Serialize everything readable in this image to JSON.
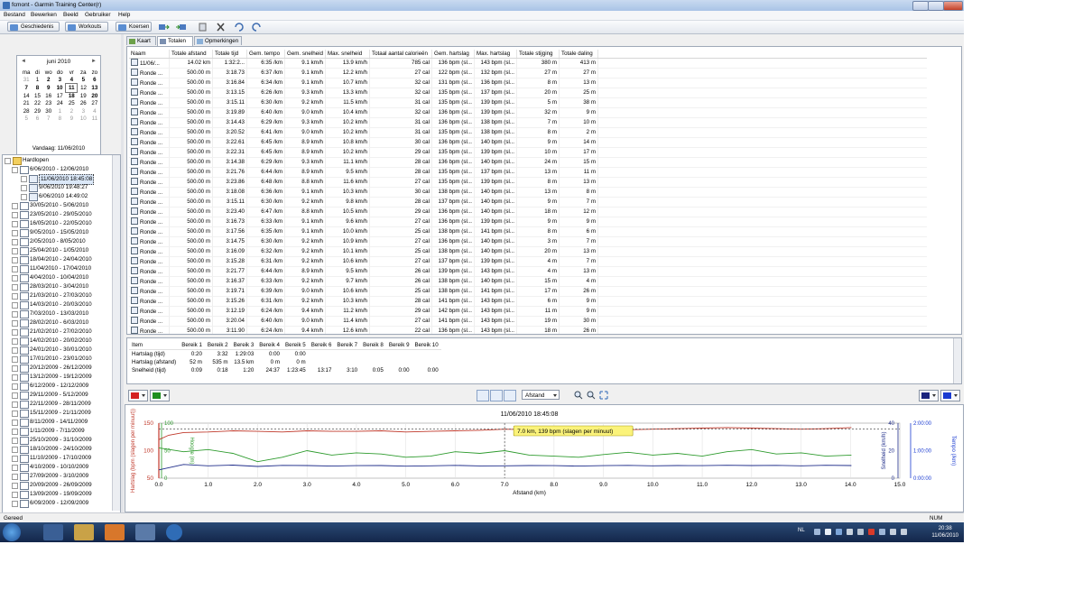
{
  "window": {
    "title": "fcmont - Garmin Training Center(r)"
  },
  "menu": [
    "Bestand",
    "Bewerken",
    "Beeld",
    "Gebruiker",
    "Help"
  ],
  "toolbar": {
    "history": "Geschiedenis",
    "workouts": "Workouts",
    "courses": "Koersen"
  },
  "calendar": {
    "caption": "juni 2010",
    "days": [
      "ma",
      "di",
      "wo",
      "do",
      "vr",
      "za",
      "zo"
    ],
    "weeks": [
      [
        "31",
        "1",
        "2",
        "3",
        "4",
        "5",
        "6"
      ],
      [
        "7",
        "8",
        "9",
        "10",
        "11",
        "12",
        "13"
      ],
      [
        "14",
        "15",
        "16",
        "17",
        "18",
        "19",
        "20"
      ],
      [
        "21",
        "22",
        "23",
        "24",
        "25",
        "26",
        "27"
      ],
      [
        "28",
        "29",
        "30",
        "1",
        "2",
        "3",
        "4"
      ],
      [
        "5",
        "6",
        "7",
        "8",
        "9",
        "10",
        "11"
      ]
    ],
    "today": "Vandaag: 11/06/2010"
  },
  "tree": {
    "root": "Hardlopen",
    "open_week": "6/06/2010 - 12/06/2010",
    "open_runs": [
      "11/06/2010 18:45:08",
      "9/06/2010 19:48:27",
      "6/06/2010 14:49:02"
    ],
    "weeks": [
      "30/05/2010 - 5/06/2010",
      "23/05/2010 - 29/05/2010",
      "16/05/2010 - 22/05/2010",
      "9/05/2010 - 15/05/2010",
      "2/05/2010 - 8/05/2010",
      "25/04/2010 - 1/05/2010",
      "18/04/2010 - 24/04/2010",
      "11/04/2010 - 17/04/2010",
      "4/04/2010 - 10/04/2010",
      "28/03/2010 - 3/04/2010",
      "21/03/2010 - 27/03/2010",
      "14/03/2010 - 20/03/2010",
      "7/03/2010 - 13/03/2010",
      "28/02/2010 - 6/03/2010",
      "21/02/2010 - 27/02/2010",
      "14/02/2010 - 20/02/2010",
      "24/01/2010 - 30/01/2010",
      "17/01/2010 - 23/01/2010",
      "20/12/2009 - 26/12/2009",
      "13/12/2009 - 19/12/2009",
      "6/12/2009 - 12/12/2009",
      "29/11/2009 - 5/12/2009",
      "22/11/2009 - 28/11/2009",
      "15/11/2009 - 21/11/2009",
      "8/11/2009 - 14/11/2009",
      "1/11/2009 - 7/11/2009",
      "25/10/2009 - 31/10/2009",
      "18/10/2009 - 24/10/2009",
      "11/10/2009 - 17/10/2009",
      "4/10/2009 - 10/10/2009",
      "27/09/2009 - 3/10/2009",
      "20/09/2009 - 26/09/2009",
      "13/09/2009 - 19/09/2009",
      "6/09/2009 - 12/09/2009"
    ]
  },
  "tabs": [
    "Kaart",
    "Totalen",
    "Opmerkingen"
  ],
  "laps": {
    "columns": [
      "Naam",
      "Totale afstand",
      "Totale tijd",
      "Gem. tempo",
      "Gem. snelheid",
      "Max. snelheid",
      "Totaal aantal calorieën",
      "Gem. hartslag",
      "Max. hartslag",
      "Totale stijging",
      "Totale daling"
    ],
    "rows": [
      [
        "11/06/...",
        "14.02 km",
        "1:32:2...",
        "6:35 /km",
        "9.1 km/h",
        "13.9 km/h",
        "785 cal",
        "136 bpm (sl...",
        "143 bpm (sl...",
        "380 m",
        "413 m"
      ],
      [
        "Ronde ...",
        "500.00 m",
        "3:18.73",
        "6:37 /km",
        "9.1 km/h",
        "12.2 km/h",
        "27 cal",
        "122 bpm (sl...",
        "132 bpm (sl...",
        "27 m",
        "27 m"
      ],
      [
        "Ronde ...",
        "500.00 m",
        "3:16.84",
        "6:34 /km",
        "9.1 km/h",
        "10.7 km/h",
        "32 cal",
        "131 bpm (sl...",
        "136 bpm (sl...",
        "8 m",
        "13 m"
      ],
      [
        "Ronde ...",
        "500.00 m",
        "3:13.15",
        "6:26 /km",
        "9.3 km/h",
        "13.3 km/h",
        "32 cal",
        "135 bpm (sl...",
        "137 bpm (sl...",
        "20 m",
        "25 m"
      ],
      [
        "Ronde ...",
        "500.00 m",
        "3:15.11",
        "6:30 /km",
        "9.2 km/h",
        "11.5 km/h",
        "31 cal",
        "135 bpm (sl...",
        "139 bpm (sl...",
        "5 m",
        "38 m"
      ],
      [
        "Ronde ...",
        "500.00 m",
        "3:19.89",
        "6:40 /km",
        "9.0 km/h",
        "10.4 km/h",
        "32 cal",
        "136 bpm (sl...",
        "139 bpm (sl...",
        "32 m",
        "9 m"
      ],
      [
        "Ronde ...",
        "500.00 m",
        "3:14.43",
        "6:29 /km",
        "9.3 km/h",
        "10.2 km/h",
        "31 cal",
        "136 bpm (sl...",
        "138 bpm (sl...",
        "7 m",
        "10 m"
      ],
      [
        "Ronde ...",
        "500.00 m",
        "3:20.52",
        "6:41 /km",
        "9.0 km/h",
        "10.2 km/h",
        "31 cal",
        "135 bpm (sl...",
        "138 bpm (sl...",
        "8 m",
        "2 m"
      ],
      [
        "Ronde ...",
        "500.00 m",
        "3:22.61",
        "6:45 /km",
        "8.9 km/h",
        "10.8 km/h",
        "30 cal",
        "136 bpm (sl...",
        "140 bpm (sl...",
        "9 m",
        "14 m"
      ],
      [
        "Ronde ...",
        "500.00 m",
        "3:22.31",
        "6:45 /km",
        "8.9 km/h",
        "10.2 km/h",
        "29 cal",
        "135 bpm (sl...",
        "139 bpm (sl...",
        "10 m",
        "17 m"
      ],
      [
        "Ronde ...",
        "500.00 m",
        "3:14.38",
        "6:29 /km",
        "9.3 km/h",
        "11.1 km/h",
        "28 cal",
        "136 bpm (sl...",
        "140 bpm (sl...",
        "24 m",
        "15 m"
      ],
      [
        "Ronde ...",
        "500.00 m",
        "3:21.76",
        "6:44 /km",
        "8.9 km/h",
        "9.5 km/h",
        "28 cal",
        "135 bpm (sl...",
        "137 bpm (sl...",
        "13 m",
        "11 m"
      ],
      [
        "Ronde ...",
        "500.00 m",
        "3:23.86",
        "6:48 /km",
        "8.8 km/h",
        "11.6 km/h",
        "27 cal",
        "135 bpm (sl...",
        "139 bpm (sl...",
        "8 m",
        "13 m"
      ],
      [
        "Ronde ...",
        "500.00 m",
        "3:18.08",
        "6:36 /km",
        "9.1 km/h",
        "10.3 km/h",
        "30 cal",
        "138 bpm (sl...",
        "140 bpm (sl...",
        "13 m",
        "8 m"
      ],
      [
        "Ronde ...",
        "500.00 m",
        "3:15.11",
        "6:30 /km",
        "9.2 km/h",
        "9.8 km/h",
        "28 cal",
        "137 bpm (sl...",
        "140 bpm (sl...",
        "9 m",
        "7 m"
      ],
      [
        "Ronde ...",
        "500.00 m",
        "3:23.40",
        "6:47 /km",
        "8.8 km/h",
        "10.5 km/h",
        "29 cal",
        "136 bpm (sl...",
        "140 bpm (sl...",
        "18 m",
        "12 m"
      ],
      [
        "Ronde ...",
        "500.00 m",
        "3:16.73",
        "6:33 /km",
        "9.1 km/h",
        "9.6 km/h",
        "27 cal",
        "136 bpm (sl...",
        "139 bpm (sl...",
        "9 m",
        "9 m"
      ],
      [
        "Ronde ...",
        "500.00 m",
        "3:17.56",
        "6:35 /km",
        "9.1 km/h",
        "10.0 km/h",
        "25 cal",
        "138 bpm (sl...",
        "141 bpm (sl...",
        "8 m",
        "6 m"
      ],
      [
        "Ronde ...",
        "500.00 m",
        "3:14.75",
        "6:30 /km",
        "9.2 km/h",
        "10.9 km/h",
        "27 cal",
        "136 bpm (sl...",
        "140 bpm (sl...",
        "3 m",
        "7 m"
      ],
      [
        "Ronde ...",
        "500.00 m",
        "3:16.09",
        "6:32 /km",
        "9.2 km/h",
        "10.1 km/h",
        "25 cal",
        "138 bpm (sl...",
        "140 bpm (sl...",
        "20 m",
        "13 m"
      ],
      [
        "Ronde ...",
        "500.00 m",
        "3:15.28",
        "6:31 /km",
        "9.2 km/h",
        "10.6 km/h",
        "27 cal",
        "137 bpm (sl...",
        "139 bpm (sl...",
        "4 m",
        "7 m"
      ],
      [
        "Ronde ...",
        "500.00 m",
        "3:21.77",
        "6:44 /km",
        "8.9 km/h",
        "9.5 km/h",
        "26 cal",
        "139 bpm (sl...",
        "143 bpm (sl...",
        "4 m",
        "13 m"
      ],
      [
        "Ronde ...",
        "500.00 m",
        "3:16.37",
        "6:33 /km",
        "9.2 km/h",
        "9.7 km/h",
        "26 cal",
        "138 bpm (sl...",
        "140 bpm (sl...",
        "15 m",
        "4 m"
      ],
      [
        "Ronde ...",
        "500.00 m",
        "3:19.71",
        "6:39 /km",
        "9.0 km/h",
        "10.6 km/h",
        "25 cal",
        "138 bpm (sl...",
        "141 bpm (sl...",
        "17 m",
        "26 m"
      ],
      [
        "Ronde ...",
        "500.00 m",
        "3:15.26",
        "6:31 /km",
        "9.2 km/h",
        "10.3 km/h",
        "28 cal",
        "141 bpm (sl...",
        "143 bpm (sl...",
        "6 m",
        "9 m"
      ],
      [
        "Ronde ...",
        "500.00 m",
        "3:12.19",
        "6:24 /km",
        "9.4 km/h",
        "11.2 km/h",
        "29 cal",
        "142 bpm (sl...",
        "143 bpm (sl...",
        "11 m",
        "9 m"
      ],
      [
        "Ronde ...",
        "500.00 m",
        "3:20.04",
        "6:40 /km",
        "9.0 km/h",
        "11.4 km/h",
        "27 cal",
        "141 bpm (sl...",
        "143 bpm (sl...",
        "19 m",
        "30 m"
      ],
      [
        "Ronde ...",
        "500.00 m",
        "3:11.90",
        "6:24 /km",
        "9.4 km/h",
        "12.6 km/h",
        "22 cal",
        "136 bpm (sl...",
        "143 bpm (sl...",
        "18 m",
        "26 m"
      ],
      [
        "Ronde ...",
        "500.00 m",
        "3:16",
        "6:32 /km",
        "9.2 km/h",
        "13.9 km/h",
        "25 cal",
        "138 bpm (sl...",
        "143 bpm (sl...",
        "34 m",
        "33 m"
      ],
      [
        "Ronde ...",
        "23.86 m",
        "0:09.25",
        "6:28 /km",
        "9.3 km/h",
        "8.9 km/h",
        "1 cal",
        "139 bpm (sl...",
        "139 bpm (sl...",
        "",
        ""
      ]
    ]
  },
  "zones": {
    "columns": [
      "Item",
      "Bereik 1",
      "Bereik 2",
      "Bereik 3",
      "Bereik 4",
      "Bereik 5",
      "Bereik 6",
      "Bereik 7",
      "Bereik 8",
      "Bereik 9",
      "Bereik 10"
    ],
    "rows": [
      [
        "Hartslag (tijd)",
        "0:20",
        "3:32",
        "1:29:03",
        "0:00",
        "0:00",
        "",
        "",
        "",
        "",
        ""
      ],
      [
        "Hartslag (afstand)",
        "52 m",
        "535 m",
        "13.5 km",
        "0 m",
        "0 m",
        "",
        "",
        "",
        "",
        ""
      ],
      [
        "Snelheid (tijd)",
        "0:09",
        "0:18",
        "1:20",
        "24:37",
        "1:23:45",
        "13:17",
        "3:10",
        "0:05",
        "0:00",
        "0:00"
      ]
    ]
  },
  "chart_toolbar": {
    "axis_select": "Afstand"
  },
  "chart_data": {
    "type": "line",
    "title": "11/06/2010 18:45:08",
    "xlabel": "Afstand (km)",
    "xlim": [
      0,
      15
    ],
    "x_ticks": [
      "0.0",
      "1.0",
      "2.0",
      "3.0",
      "4.0",
      "5.0",
      "6.0",
      "7.0",
      "8.0",
      "9.0",
      "10.0",
      "11.0",
      "12.0",
      "13.0",
      "14.0",
      "15.0"
    ],
    "y_left_label": "Hartslag (bpm (slagen per minuut))",
    "y_left_ticks": [
      "150",
      "100",
      "50"
    ],
    "y_left_range": [
      50,
      150
    ],
    "y_left2_label": "Hoogte (m)",
    "y_left2_ticks": [
      "100",
      "50",
      "0"
    ],
    "y_right_label": "Snelheid (km/h)",
    "y_right_ticks": [
      "40",
      "20",
      "0"
    ],
    "y_right2_label": "Tempo (/km)",
    "y_right2_ticks": [
      "2:00:00",
      "1:00:00",
      "0:00:00"
    ],
    "cursor_x": 7.0,
    "tooltip": "7.0 km, 139 bpm (slagen per minuut)",
    "series": [
      {
        "name": "Hartslag",
        "color": "#c0392b",
        "x": [
          0,
          0.2,
          0.5,
          1,
          1.5,
          2,
          2.5,
          3,
          3.5,
          4,
          4.5,
          5,
          5.5,
          6,
          6.5,
          7,
          7.5,
          8,
          8.5,
          9,
          9.5,
          10,
          10.5,
          11,
          11.5,
          12,
          12.5,
          13,
          13.5,
          14.02
        ],
        "y": [
          120,
          128,
          133,
          134,
          136,
          135,
          134,
          136,
          135,
          135,
          136,
          134,
          135,
          136,
          137,
          139,
          138,
          137,
          138,
          139,
          138,
          139,
          140,
          141,
          142,
          141,
          140,
          139,
          140,
          142
        ]
      },
      {
        "name": "Hoogte",
        "color": "#2e9b2e",
        "x": [
          0,
          0.5,
          1,
          1.5,
          2,
          2.5,
          3,
          3.5,
          4,
          4.5,
          5,
          5.5,
          6,
          6.5,
          7,
          7.5,
          8,
          8.5,
          9,
          9.5,
          10,
          10.5,
          11,
          11.5,
          12,
          12.5,
          13,
          13.5,
          14.02
        ],
        "y": [
          55,
          48,
          52,
          45,
          30,
          38,
          50,
          42,
          46,
          44,
          38,
          40,
          48,
          45,
          50,
          42,
          40,
          38,
          43,
          47,
          42,
          45,
          40,
          48,
          52,
          44,
          46,
          40,
          42
        ]
      },
      {
        "name": "Snelheid",
        "color": "#1f2d8a",
        "x": [
          0,
          0.5,
          1,
          1.5,
          2,
          2.5,
          3,
          3.5,
          4,
          4.5,
          5,
          5.5,
          6,
          6.5,
          7,
          7.5,
          8,
          8.5,
          9,
          9.5,
          10,
          10.5,
          11,
          11.5,
          12,
          12.5,
          13,
          13.5,
          14.02
        ],
        "y": [
          6,
          10,
          9,
          9.5,
          8.5,
          9.3,
          9.2,
          8.8,
          9.1,
          9.2,
          8.7,
          9.0,
          9.3,
          8.9,
          9.0,
          9.2,
          9.1,
          8.8,
          9.1,
          9.3,
          9.0,
          9.2,
          9.1,
          9.4,
          9.2,
          9.3,
          9.0,
          9.4,
          9.2
        ]
      }
    ]
  },
  "status": {
    "left": "Gereed",
    "right": "NUM"
  },
  "taskbar": {
    "lang": "NL",
    "time": "20:38",
    "date": "11/06/2010"
  }
}
